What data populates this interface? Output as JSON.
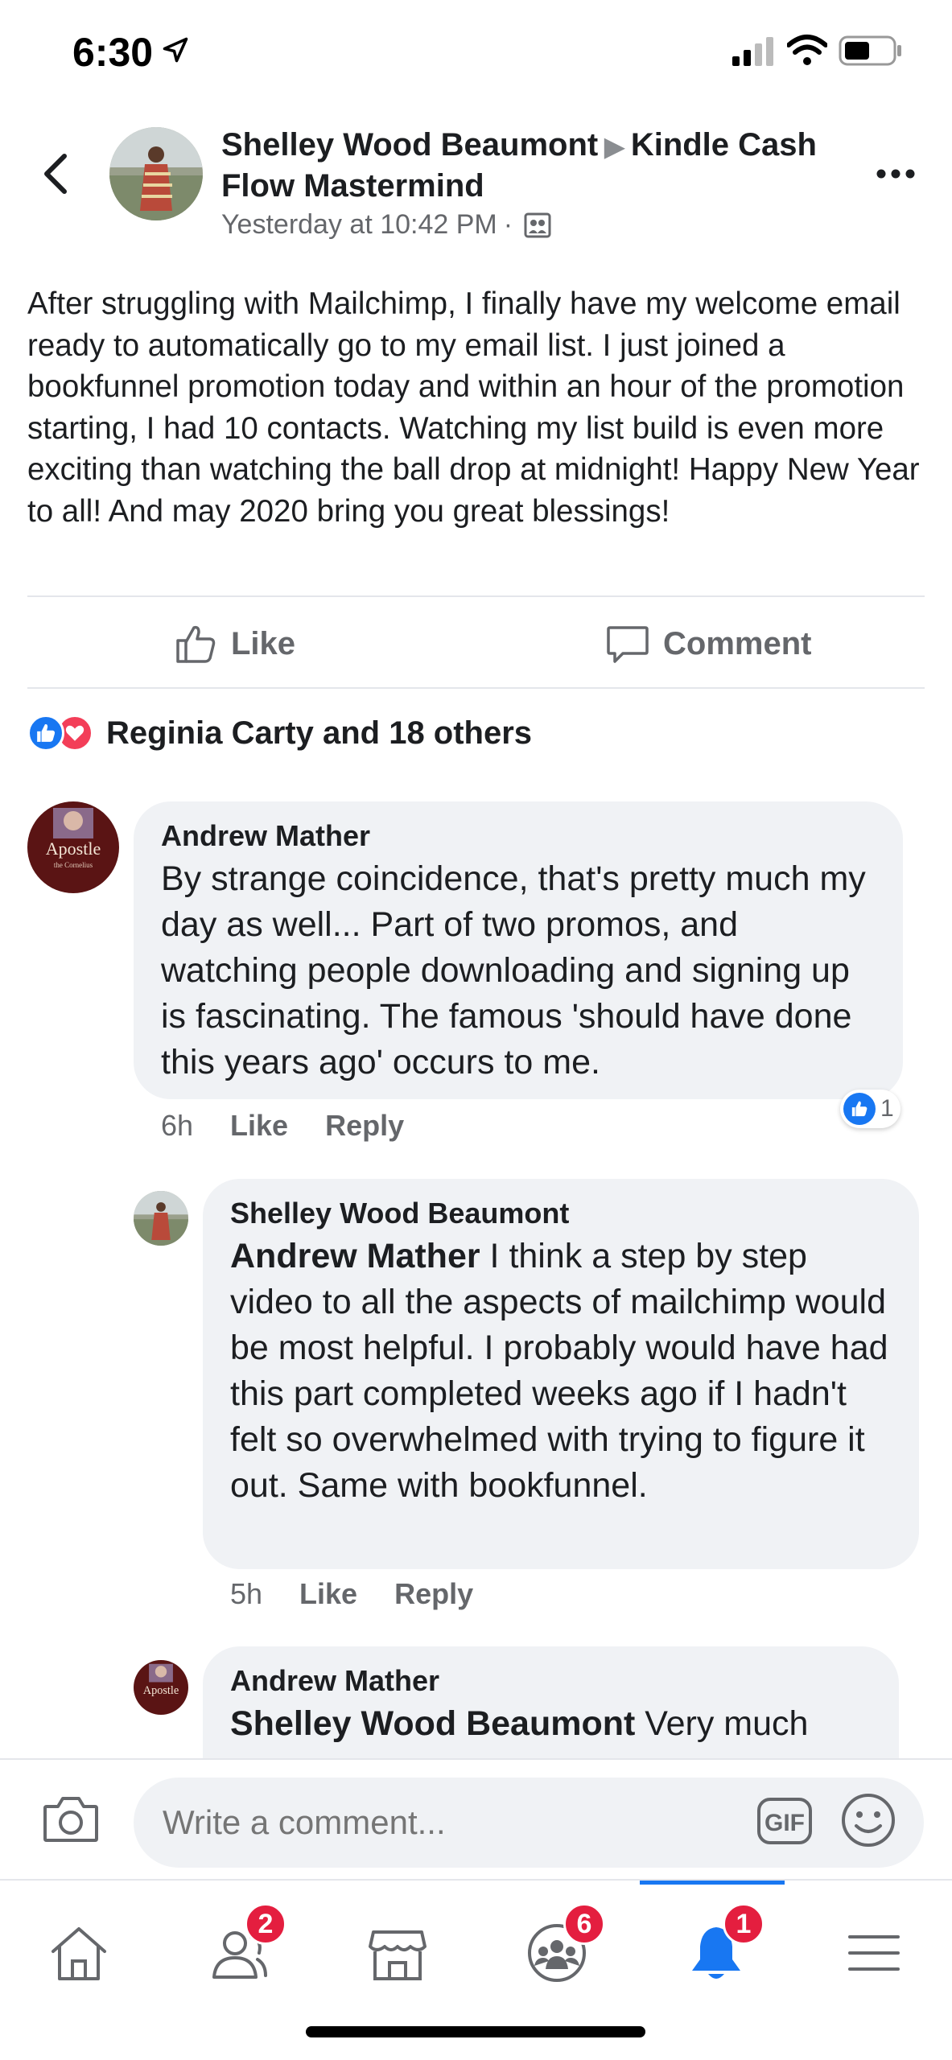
{
  "status_bar": {
    "time": "6:30"
  },
  "post": {
    "author": "Shelley Wood Beaumont",
    "group": "Kindle Cash Flow Mastermind",
    "timestamp": "Yesterday at 10:42 PM",
    "separator": "·",
    "body": "After struggling with Mailchimp, I finally have my welcome email ready to automatically go to my email list. I just joined a bookfunnel promotion today and within an hour of the promotion starting, I had 10 contacts. Watching my list build is even more exciting than watching the ball drop at midnight! Happy New Year to all! And may 2020 bring you great blessings!",
    "like_label": "Like",
    "comment_label": "Comment",
    "reactions_text": "Reginia Carty and 18 others"
  },
  "comments": [
    {
      "name": "Andrew Mather",
      "text": "By strange coincidence, that's pretty much my day as well... Part of two promos, and watching people downloading and signing up is fascinating. The famous 'should have done this years ago' occurs to me.",
      "time": "6h",
      "like_label": "Like",
      "reply_label": "Reply",
      "reaction_count": "1"
    },
    {
      "name": "Shelley Wood Beaumont",
      "mention": "Andrew Mather",
      "text": " I think a step by step video to all the aspects of mailchimp would be most helpful. I probably would have had this part completed weeks ago if I hadn't felt so overwhelmed with trying to figure it out. Same with bookfunnel.",
      "time": "5h",
      "like_label": "Like",
      "reply_label": "Reply"
    },
    {
      "name": "Andrew Mather",
      "mention": "Shelley Wood Beaumont",
      "text": " Very much"
    }
  ],
  "avatar_text": {
    "title": "Apostle",
    "subtitle": "the Cornelius"
  },
  "composer": {
    "placeholder": "Write a comment...",
    "gif_label": "GIF"
  },
  "nav": {
    "friends_badge": "2",
    "groups_badge": "6",
    "notifications_badge": "1"
  },
  "colors": {
    "accent": "#1877f2",
    "badge": "#e41e3f",
    "bubble": "#f0f2f5"
  }
}
